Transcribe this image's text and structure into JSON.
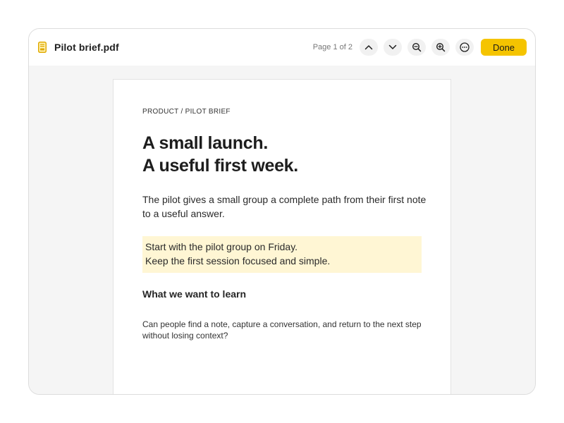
{
  "toolbar": {
    "file_icon": "pdf-file-icon",
    "file_name": "Pilot brief.pdf",
    "page_indicator": "Page 1 of 2",
    "buttons": [
      {
        "name": "previous-page-button",
        "icon": "chevron-up-icon"
      },
      {
        "name": "next-page-button",
        "icon": "chevron-down-icon"
      },
      {
        "name": "zoom-out-button",
        "icon": "zoom-out-icon"
      },
      {
        "name": "zoom-in-button",
        "icon": "zoom-in-icon"
      },
      {
        "name": "more-options-button",
        "icon": "more-horizontal-icon"
      }
    ],
    "done_label": "Done",
    "accent_color": "#f5c400"
  },
  "document": {
    "eyebrow": "PRODUCT / PILOT BRIEF",
    "headline": [
      "A small launch.",
      "A useful first week."
    ],
    "intro": "The pilot gives a small group a complete path from their first note to a useful answer.",
    "highlight": [
      "Start with the pilot group on Friday.",
      "Keep the first session focused and simple."
    ],
    "highlight_color": "#fff6d4",
    "section_heading": "What we want to learn",
    "section_body": "Can people find a note, capture a conversation, and return to the next step without losing context?"
  }
}
